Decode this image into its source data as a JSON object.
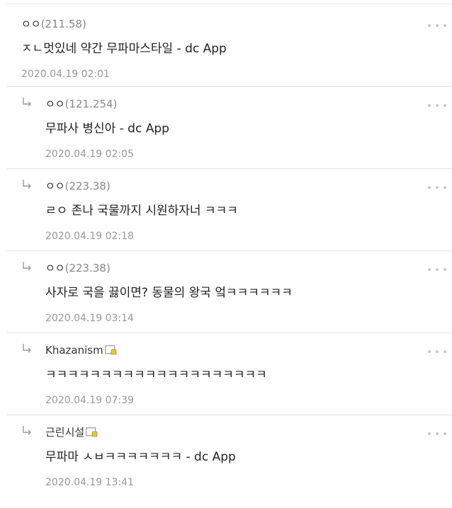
{
  "comments": [
    {
      "nick": "ㅇㅇ",
      "ip": "(211.58)",
      "text": "ㅈㄴ멋있네 약간 무파마스타일 - dc App",
      "date": "2020.04.19 02:01",
      "is_reply": false,
      "has_icon": false
    },
    {
      "nick": "ㅇㅇ",
      "ip": "(121.254)",
      "text": "무파사 병신아 - dc App",
      "date": "2020.04.19 02:05",
      "is_reply": true,
      "has_icon": false
    },
    {
      "nick": "ㅇㅇ",
      "ip": "(223.38)",
      "text": "ㄹㅇ 존나 국물까지 시원하자너 ㅋㅋㅋ",
      "date": "2020.04.19 02:18",
      "is_reply": true,
      "has_icon": false
    },
    {
      "nick": "ㅇㅇ",
      "ip": "(223.38)",
      "text": "사자로 국을 끓이면? 동물의 왕국 엌ㅋㅋㅋㅋㅋㅋ",
      "date": "2020.04.19 03:14",
      "is_reply": true,
      "has_icon": false
    },
    {
      "nick": "Khazanism",
      "ip": "",
      "text": "ㅋㅋㅋㅋㅋㅋㅋㅋㅋㅋㅋㅋㅋㅋㅋㅋㅋㅋㅋㅋ",
      "date": "2020.04.19 07:39",
      "is_reply": true,
      "has_icon": true
    },
    {
      "nick": "근린시설",
      "ip": "",
      "text": "무파마 ㅅㅂㅋㅋㅋㅋㅋㅋㅋ - dc App",
      "date": "2020.04.19 13:41",
      "is_reply": true,
      "has_icon": true
    }
  ],
  "icons": {
    "reply": "reply-arrow-icon",
    "more": "more-options-icon",
    "nick": "fixed-nick-icon"
  },
  "colors": {
    "nick_icon_frame": "#9a9a9a",
    "nick_icon_badge": "#e7c53a",
    "separator": "#e3e3e3",
    "date": "#999999"
  }
}
